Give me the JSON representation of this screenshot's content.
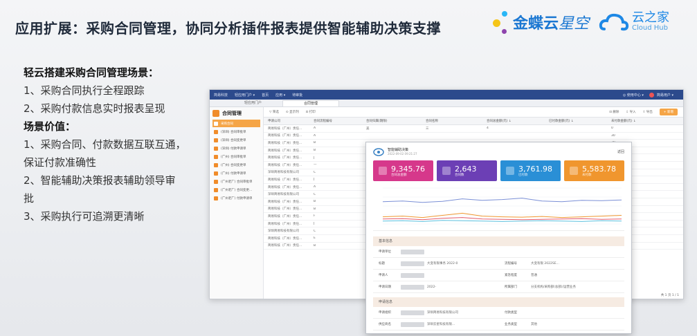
{
  "slide": {
    "title": "应用扩展：采购合同管理，协同分析插件报表提供智能辅助决策支撑"
  },
  "logos": {
    "kingdee_brand": "金蝶云",
    "kingdee_product": "星空",
    "yunzhijia_cn": "云之家",
    "yunzhijia_en": "Cloud Hub",
    "colors": {
      "kingdee_blue": "#1b77d2",
      "dot_purple": "#8e44ad",
      "dot_yellow": "#f5c518",
      "dot_cyan": "#29b6f6"
    }
  },
  "left_text": [
    {
      "text": "轻云搭建采购合同管理场景：",
      "bold": true
    },
    {
      "text": "1、采购合同执行全程跟踪",
      "bold": false
    },
    {
      "text": "2、采购付款信息实时报表呈现",
      "bold": false
    },
    {
      "text": "场景价值：",
      "bold": true
    },
    {
      "text": "1、采购合同、付款数据互联互通，",
      "bold": false
    },
    {
      "text": "保证付款准确性",
      "bold": false
    },
    {
      "text": "2、智能辅助决策报表辅助领导审",
      "bold": false
    },
    {
      "text": "批",
      "bold": false
    },
    {
      "text": "3、采购执行可追溯更清晰",
      "bold": false
    }
  ],
  "app": {
    "topbar": {
      "app_name": "简易科技",
      "nav": [
        "轻应用门户 ▾",
        "首页",
        "应用 ▾",
        "待审批"
      ],
      "right": [
        "◎ 使用中心 ▾",
        "简易用户 ▾"
      ]
    },
    "tabs": [
      "轻应用门户",
      "合同管理"
    ],
    "sidebar_title": "合同管理",
    "sidebar_items": [
      "采购合同",
      "(深圳) 合同审批单",
      "(深圳) 合同变更单",
      "(深圳) 付款申请单",
      "(广州) 合同审批单",
      "(广州) 合同变更单",
      "(广州) 付款申请单",
      "(广州老厂) 合同审批单",
      "(广州老厂) 合同变更...",
      "(广州老厂) 付款申请单"
    ],
    "toolbar": {
      "left": [
        "▽ 筛选",
        "⊙ 显示列",
        "⊡ 打印"
      ],
      "right": [
        "⊡ 删除",
        "⇩ 导入",
        "⇧ 导出"
      ],
      "new_button": "+ 新增"
    },
    "columns": [
      "申请公司",
      "合同流程编号",
      "合同归属(期限)",
      "合同名称",
      "合同总金额(元) ↓",
      "已付款金额(元) ↓",
      "未付款金额(元) ↓"
    ],
    "rows": [
      [
        "简易科技（广州）责任...",
        "A",
        "美",
        "三",
        "4",
        "",
        "0"
      ],
      [
        "简易科技（广州）责任...",
        "A",
        "",
        "",
        "",
        "",
        "30"
      ],
      [
        "简易科技（广州）责任...",
        "B",
        "",
        "",
        "",
        "",
        "30"
      ],
      [
        "简易科技（广州）责任...",
        "B",
        "",
        "",
        "",
        "",
        "0"
      ],
      [
        "简易科技（广州）责任...",
        "J",
        "",
        "",
        "",
        "",
        "1.00"
      ],
      [
        "简易科技（广州）责任...",
        "—",
        "",
        "",
        "",
        "",
        "0"
      ],
      [
        "深圳简易科技有限公司",
        "C",
        "",
        "",
        "",
        "",
        "0"
      ],
      [
        "简易科技（广州）责任...",
        "J",
        "",
        "",
        "",
        "",
        "0"
      ],
      [
        "简易科技（广州）责任...",
        "A",
        "",
        "",
        "",
        "",
        "0"
      ],
      [
        "深圳简易科技有限公司",
        "C",
        "",
        "",
        "",
        "",
        "1"
      ],
      [
        "简易科技（广州）责任...",
        "B",
        "",
        "",
        "",
        "",
        "1"
      ],
      [
        "简易科技（广州）责任...",
        "B",
        "",
        "",
        "",
        "",
        "1"
      ],
      [
        "简易科技（广州）责任...",
        "F",
        "",
        "",
        "",
        "",
        "1"
      ],
      [
        "简易科技（广州）责任...",
        "J",
        "",
        "",
        "",
        "",
        "30"
      ],
      [
        "深圳简易科技有限公司",
        "C",
        "",
        "",
        "",
        "",
        "0"
      ],
      [
        "简易科技（广州）责任...",
        "E",
        "",
        "",
        "",
        "",
        "30"
      ],
      [
        "简易科技（广州）责任...",
        "B",
        "",
        "",
        "",
        "",
        "30"
      ]
    ],
    "pager": "共 1 页   1 / 1"
  },
  "report": {
    "title": "智能辅助决策",
    "subtitle": "2022-09-02 09:21:27",
    "back": "返回",
    "cards": [
      {
        "value": "9,345.76",
        "label": "合同总金额",
        "color": "#d6388b"
      },
      {
        "value": "2,643",
        "label": "合同数",
        "color": "#6c3fb5"
      },
      {
        "value": "3,761.98",
        "label": "已付款",
        "color": "#2a8fd6"
      },
      {
        "value": "5,583.78",
        "label": "未付款",
        "color": "#f0962e"
      }
    ],
    "section1_title": "基本信息",
    "section2_title": "申请信息",
    "fields": [
      {
        "l1": "申请单位",
        "v1": "",
        "l2": "",
        "v2": ""
      },
      {
        "l1": "标题",
        "v1": "大变有限事务 2022-0",
        "l2": "流程编号",
        "v2": "大变有限 2022SE..."
      },
      {
        "l1": "申请人",
        "v1": "",
        "l2": "紧急程度",
        "v2": "普通"
      },
      {
        "l1": "申请日期",
        "v1": "2022-",
        "l2": "所属部门",
        "v2": "分支机构/采购部(总部)/运营业务"
      }
    ],
    "fields2": [
      {
        "l1": "申请组织",
        "v1": "深圳简易科技有限公司",
        "l2": "付款类型",
        "v2": ""
      },
      {
        "l1": "供应商名",
        "v1": "深圳云星科技有限...",
        "l2": "业务类型",
        "v2": "其他"
      }
    ]
  },
  "chart_data": {
    "type": "line",
    "series": [
      {
        "values": [
          62,
          64,
          60,
          63,
          70,
          66,
          68,
          72,
          64,
          62,
          66,
          65,
          67
        ],
        "color": "#7a8fd6"
      },
      {
        "values": [
          20,
          22,
          18,
          24,
          30,
          22,
          20,
          19,
          21,
          18,
          20,
          22,
          24
        ],
        "color": "#f0962e"
      },
      {
        "values": [
          14,
          15,
          12,
          16,
          18,
          14,
          13,
          12,
          13,
          14,
          15,
          13,
          14
        ],
        "color": "#e05a6b"
      },
      {
        "values": [
          8,
          9,
          7,
          10,
          9,
          8,
          7,
          8,
          9,
          8,
          7,
          9,
          8
        ],
        "color": "#5bc0de"
      }
    ],
    "ylim": [
      0,
      100
    ]
  }
}
